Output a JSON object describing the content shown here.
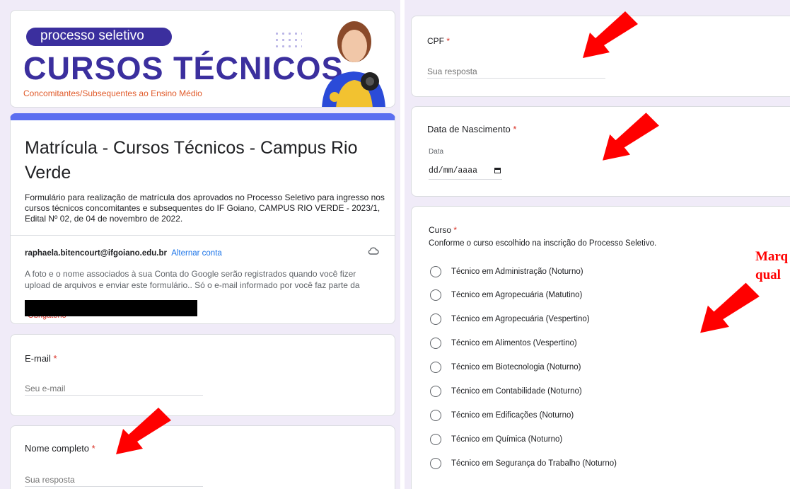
{
  "banner": {
    "pill": "processo seletivo",
    "title": "CURSOS TÉCNICOS",
    "subtitle": "Concomitantes/Subsequentes ao Ensino Médio"
  },
  "form": {
    "title": "Matrícula - Cursos Técnicos - Campus Rio Verde",
    "description": "Formulário para realização de matrícula dos aprovados no Processo Seletivo para ingresso nos cursos técnicos concomitantes e subsequentes do IF Goiano, CAMPUS RIO VERDE - 2023/1, Edital Nº 02, de 04 de novembro de 2022.",
    "account_email": "raphaela.bitencourt@ifgoiano.edu.br",
    "switch_account": "Alternar conta",
    "notice": "A foto e o nome associados à sua Conta do Google serão registrados quando você fizer upload de arquivos e enviar este formulário.. Só o e-mail informado por você faz parte da",
    "required_note": "*Obrigatório"
  },
  "questions": {
    "email": {
      "label": "E-mail",
      "required": "*",
      "placeholder": "Seu e-mail"
    },
    "nome": {
      "label": "Nome completo",
      "required": "*",
      "placeholder": "Sua resposta"
    },
    "cpf": {
      "label": "CPF",
      "required": "*",
      "placeholder": "Sua resposta"
    },
    "nascimento": {
      "label": "Data de Nascimento",
      "required": "*",
      "sublabel": "Data",
      "value": "dd/mm/aaaa"
    },
    "curso": {
      "label": "Curso",
      "required": "*",
      "help": "Conforme o curso escolhido na inscrição do Processo Seletivo.",
      "options": [
        "Técnico em Administração (Noturno)",
        "Técnico em Agropecuária (Matutino)",
        "Técnico em Agropecuária (Vespertino)",
        "Técnico em Alimentos (Vespertino)",
        "Técnico em Biotecnologia (Noturno)",
        "Técnico em Contabilidade (Noturno)",
        "Técnico em Edificações (Noturno)",
        "Técnico em Química (Noturno)",
        "Técnico em Segurança do Trabalho (Noturno)"
      ]
    }
  },
  "annotation": {
    "line1": "Marq",
    "line2": "qual"
  },
  "colors": {
    "accent": "#5b6ef0",
    "required": "#d93025",
    "arrow": "#ff0000",
    "banner_blue": "#3b2f9e"
  }
}
